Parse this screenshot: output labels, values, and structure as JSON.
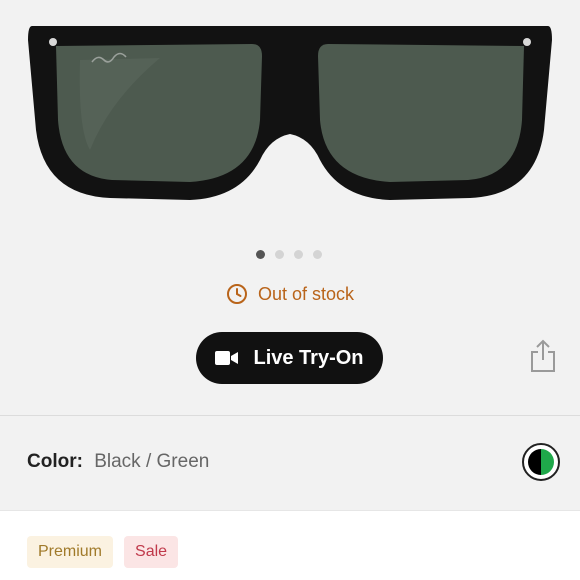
{
  "product": {
    "image_alt": "Black Wayfarer sunglasses with green lenses",
    "carousel": {
      "total": 4,
      "active_index": 0
    }
  },
  "stock": {
    "icon": "clock-icon",
    "text": "Out of stock",
    "color": "#b9641a"
  },
  "tryon": {
    "icon": "video-camera-icon",
    "label": "Live Try-On"
  },
  "share": {
    "icon": "share-icon"
  },
  "color": {
    "label": "Color:",
    "value": "Black / Green",
    "swatch_colors": [
      "#000000",
      "#1fa84a"
    ]
  },
  "badges": [
    {
      "label": "Premium",
      "variant": "premium"
    },
    {
      "label": "Sale",
      "variant": "sale"
    }
  ]
}
